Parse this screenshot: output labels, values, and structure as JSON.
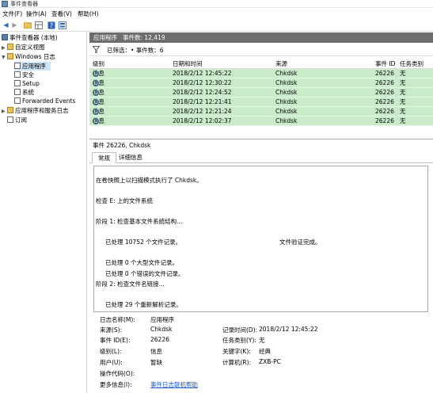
{
  "window": {
    "title": "事件查看器"
  },
  "menu": [
    "文件(F)",
    "操作(A)",
    "查看(V)",
    "帮助(H)"
  ],
  "tree": {
    "root": "事件查看器 (本地)",
    "custom_views": "自定义视图",
    "windows_logs": "Windows 日志",
    "children": [
      "应用程序",
      "安全",
      "Setup",
      "系统",
      "Forwarded Events"
    ],
    "app_service_logs": "应用程序和服务日志",
    "subscriptions": "订阅"
  },
  "header": {
    "log_name": "应用程序",
    "event_count": "事件数: 12,419"
  },
  "filter": {
    "text": "已筛选：• 事件数：6"
  },
  "columns": [
    "级别",
    "日期和时间",
    "来源",
    "事件 ID",
    "任务类别"
  ],
  "events": [
    {
      "level": "信息",
      "datetime": "2018/2/12 12:45:22",
      "source": "Chkdsk",
      "id": "26226",
      "task": "无"
    },
    {
      "level": "信息",
      "datetime": "2018/2/12 12:30:22",
      "source": "Chkdsk",
      "id": "26226",
      "task": "无"
    },
    {
      "level": "信息",
      "datetime": "2018/2/12 12:24:52",
      "source": "Chkdsk",
      "id": "26226",
      "task": "无"
    },
    {
      "level": "信息",
      "datetime": "2018/2/12 12:21:41",
      "source": "Chkdsk",
      "id": "26226",
      "task": "无"
    },
    {
      "level": "信息",
      "datetime": "2018/2/12 12:21:24",
      "source": "Chkdsk",
      "id": "26226",
      "task": "无"
    },
    {
      "level": "信息",
      "datetime": "2018/2/12 12:02:37",
      "source": "Chkdsk",
      "id": "26226",
      "task": "无"
    }
  ],
  "detail": {
    "title": "事件 26226, Chkdsk",
    "tabs": [
      "常规",
      "详细信息"
    ],
    "message": [
      "在卷快照上以扫描模式执行了 Chkdsk。",
      "检查 E: 上的文件系统",
      "阶段 1: 检查基本文件系统结构...",
      "已处理 10752 个文件记录。",
      "文件验证完成。",
      "已处理 0 个大型文件记录。",
      "已处理 0 个错误的文件记录。",
      "阶段 2: 检查文件名链接...",
      "已处理 29 个重新解析记录。"
    ],
    "props": {
      "log_name_k": "日志名称(M):",
      "log_name_v": "应用程序",
      "source_k": "来源(S):",
      "source_v": "Chkdsk",
      "recorded_k": "记录时间(D):",
      "recorded_v": "2018/2/12 12:45:22",
      "eventid_k": "事件 ID(E):",
      "eventid_v": "26226",
      "task_k": "任务类别(Y):",
      "task_v": "无",
      "level_k": "级别(L):",
      "level_v": "信息",
      "keywords_k": "关键字(K):",
      "keywords_v": "经典",
      "user_k": "用户(U):",
      "user_v": "暂缺",
      "computer_k": "计算机(R):",
      "computer_v": "ZXB-PC",
      "opcode_k": "操作代码(O):",
      "more_k": "更多信息(I):",
      "more_v": "事件日志联机帮助"
    }
  }
}
